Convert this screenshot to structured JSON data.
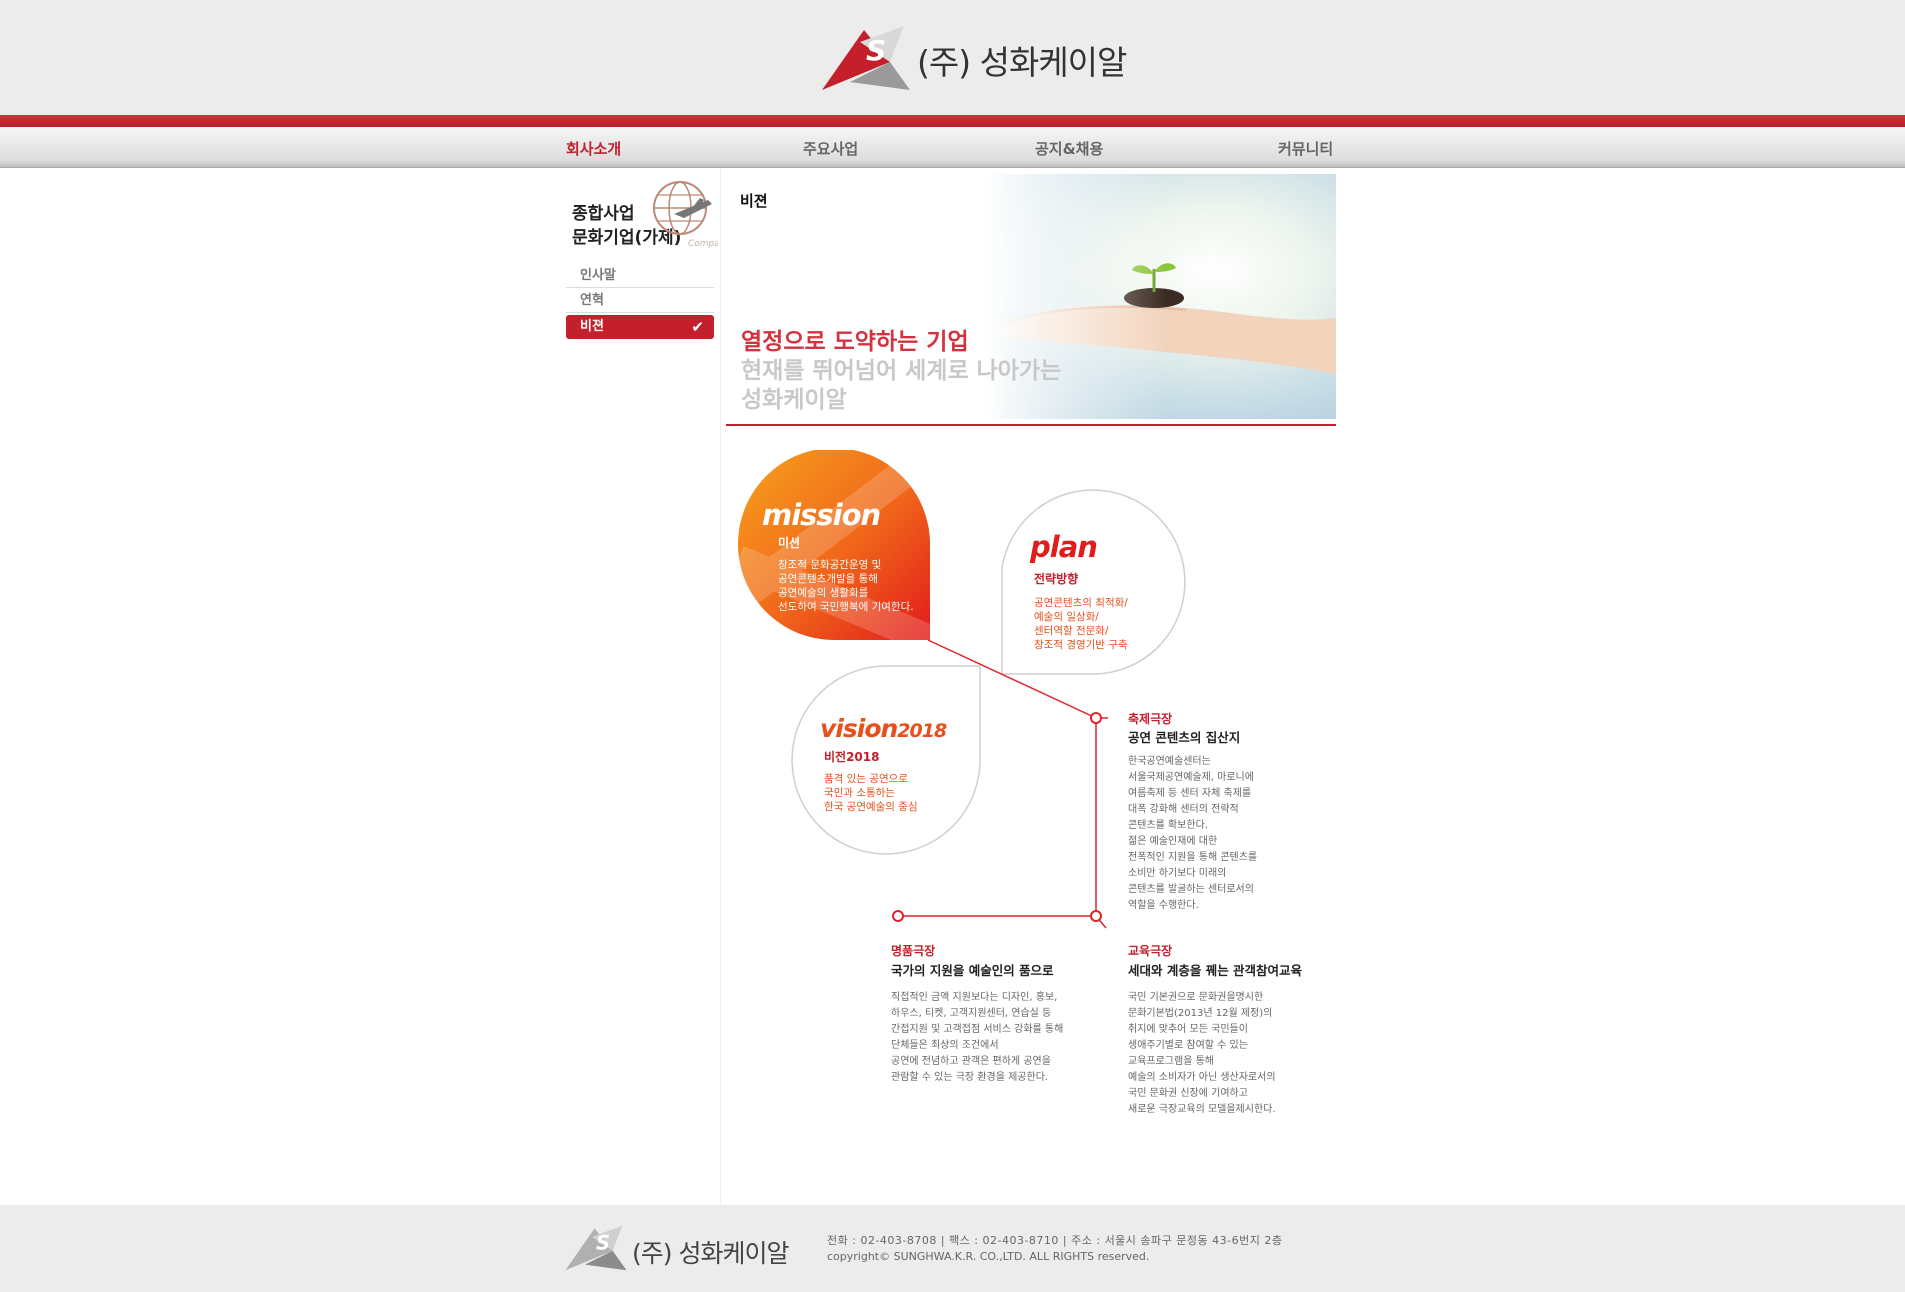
{
  "header": {
    "logo_text": "(주) 성화케이알",
    "logo_letter": "S"
  },
  "nav": {
    "items": [
      {
        "label": "회사소개",
        "active": true
      },
      {
        "label": "주요사업",
        "active": false
      },
      {
        "label": "공지&채용",
        "active": false
      },
      {
        "label": "커뮤니티",
        "active": false
      }
    ]
  },
  "sidebar": {
    "title_line1": "종합사업",
    "title_line2": "문화기업(가제)",
    "badge": "Company",
    "items": [
      {
        "label": "인사말",
        "active": false
      },
      {
        "label": "연혁",
        "active": false
      },
      {
        "label": "비젼",
        "active": true
      }
    ],
    "check_icon": "✔"
  },
  "banner": {
    "page_title": "비젼",
    "line1": "열정으로 도약하는 기업",
    "line2": "현재를 뛰어넘어 세계로 나아가는",
    "line3": "성화케이알"
  },
  "diagram": {
    "mission": {
      "title": "mission",
      "sub": "미션",
      "lines": [
        "창조적 문화공간운영 및",
        "공연콘텐츠개발을 통해",
        "공연예술의 생활화를",
        "선도하여 국민행복에 기여한다."
      ]
    },
    "plan": {
      "title": "plan",
      "sub": "전략방향",
      "lines": [
        "공연콘텐츠의 최적화/",
        "예술의 일상화/",
        "센터역할 전문화/",
        "창조적 경영기반 구축"
      ]
    },
    "vision": {
      "title": "vision",
      "title_year": "2018",
      "sub": "비전2018",
      "lines": [
        "품격 있는 공연으로",
        "국민과 소통하는",
        "한국 공연예술의 중심"
      ]
    },
    "festival": {
      "heading": "축제극장",
      "title": "공연 콘텐츠의 집산지",
      "lines": [
        "한국공연예술센터는",
        "서울국제공연예술제, 마로니에",
        "여름축제 등 센터 자체 축제를",
        "대폭 강화해 센터의 전략적",
        "콘텐츠를 확보한다.",
        "젊은 예술인재에 대한",
        "전폭적인 지원을 통해 콘텐츠를",
        "소비만 하기보다 미래의",
        "콘텐츠를 발굴하는 센터로서의",
        "역할을 수행한다."
      ]
    },
    "masterpiece": {
      "heading": "명품극장",
      "title": "국가의 지원을 예술인의 품으로",
      "lines": [
        "직접적인 금액 지원보다는 디자인, 홍보,",
        "하우스, 티켓, 고객지원센터, 연습실 등",
        "간접지원 및 고객접점 서비스 강화를 통해",
        "단체들은 최상의 조건에서",
        "공연에 전념하고 관객은 편하게 공연을",
        "관람할 수 있는 극장 환경을 제공한다."
      ]
    },
    "education": {
      "heading": "교육극장",
      "title": "세대와 계층을 꿰는 관객참여교육",
      "lines": [
        "국민 기본권으로 문화권을명시한",
        "문화기본법(2013년 12월 제정)의",
        "취지에 맞추어 모든 국민들이",
        "생애주기별로 참여할 수 있는",
        "교육프로그램을 통해",
        "예술의 소비자가 아닌 생산자로서의",
        "국민 문화권 신장에 기여하고",
        "새로운 극장교육의 모델을제시한다."
      ]
    }
  },
  "footer": {
    "logo_text": "(주) 성화케이알",
    "contact": "전화 : 02-403-8708      |      팩스 : 02-403-8710      |      주소 : 서울시 송파구 문정동 43-6번지 2층",
    "copyright": "copyright© SUNGHWA.K.R. CO.,LTD. ALL RIGHTS reserved."
  },
  "colors": {
    "brand_red": "#c4202b",
    "mission_orange": "#f0661a",
    "accent_orange": "#e8501b"
  }
}
